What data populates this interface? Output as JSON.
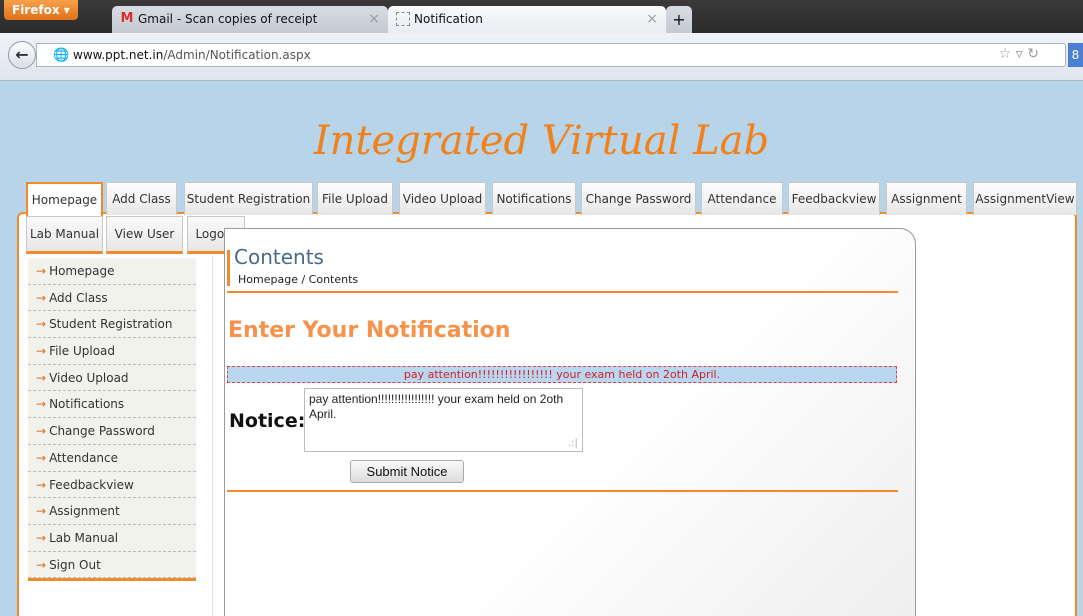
{
  "browser": {
    "menu_button": "Firefox ▾",
    "tabs": [
      {
        "title": "Gmail - Scan copies of receipt",
        "icon": "M"
      },
      {
        "title": "Notification",
        "icon": "▫"
      }
    ],
    "new_tab": "+",
    "url_host": "www.ppt.net.in",
    "url_path": "/Admin/Notification.aspx"
  },
  "site": {
    "title": "Integrated Virtual Lab"
  },
  "topnav": [
    "Homepage",
    "Add Class",
    "Student Registration",
    "File Upload",
    "Video Upload",
    "Notifications",
    "Change Password",
    "Attendance",
    "Feedbackview",
    "Assignment",
    "AssignmentView"
  ],
  "topnav_row2": [
    "Lab Manual",
    "View User",
    "Logout"
  ],
  "sidebar": [
    "Homepage",
    "Add Class",
    "Student Registration",
    "File Upload",
    "Video Upload",
    "Notifications",
    "Change Password",
    "Attendance",
    "Feedbackview",
    "Assignment",
    "Lab Manual",
    "Sign Out"
  ],
  "content": {
    "heading": "Contents",
    "breadcrumb": "Homepage / Contents",
    "form_title": "Enter Your Notification",
    "message": "pay attention!!!!!!!!!!!!!!!!! your exam held on 2oth April.",
    "notice_label": "Notice:",
    "notice_value": "pay attention!!!!!!!!!!!!!!!!! your exam held on 2oth April.",
    "submit_label": "Submit Notice"
  }
}
